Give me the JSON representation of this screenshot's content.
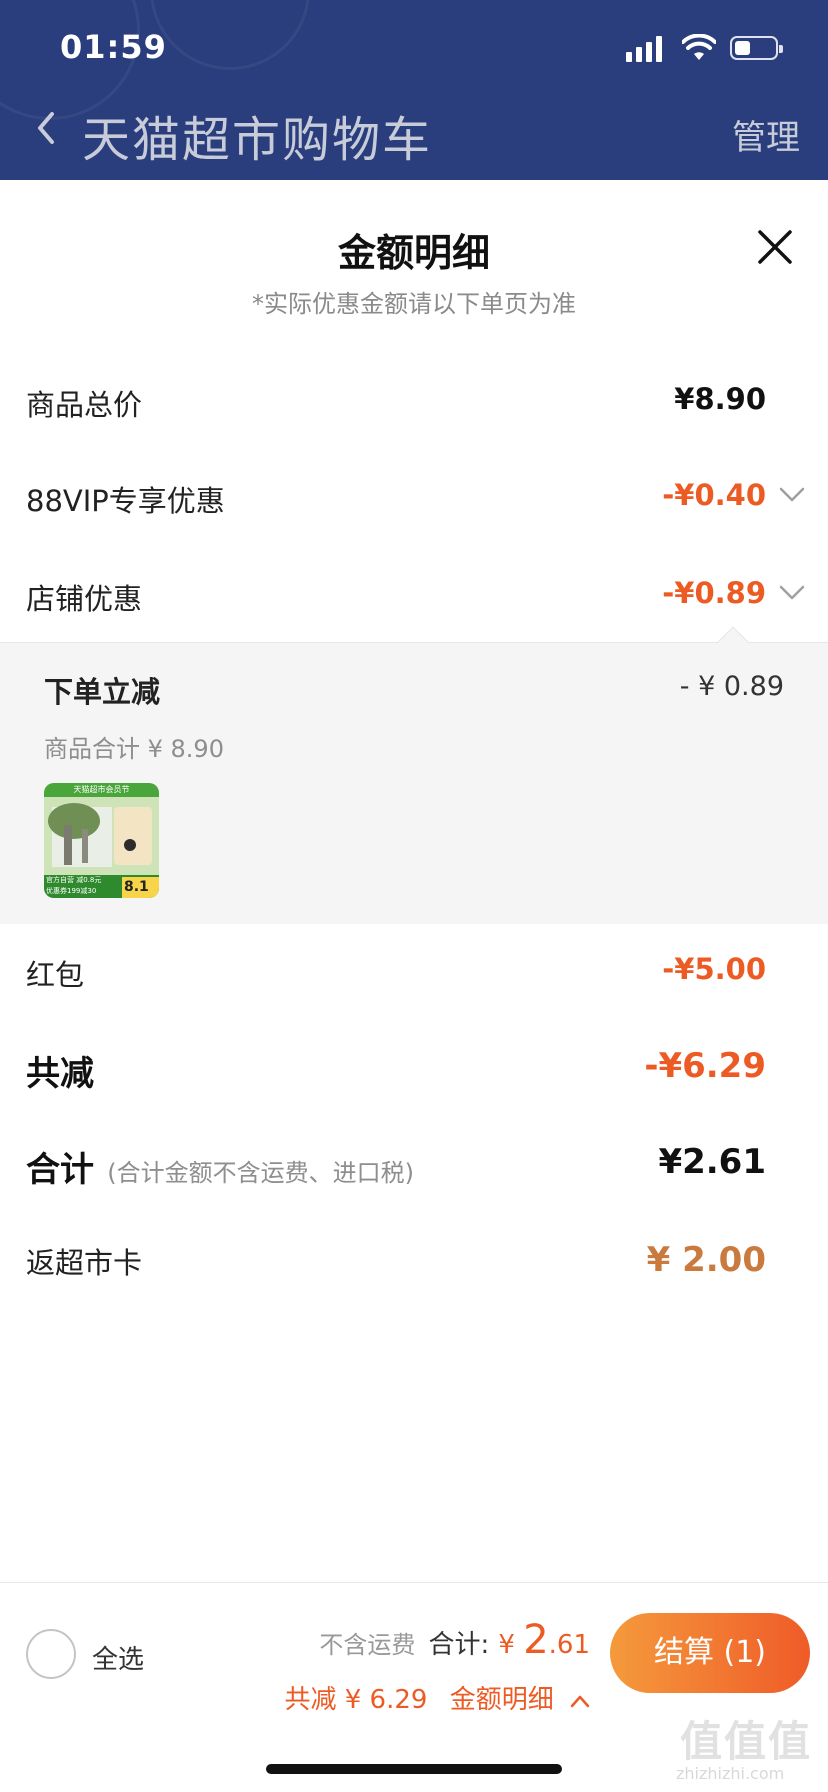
{
  "status_bar": {
    "time": "01:59"
  },
  "nav": {
    "title": "天猫超市购物车",
    "manage": "管理"
  },
  "sheet": {
    "title": "金额明细",
    "subtitle": "*实际优惠金额请以下单页为准",
    "rows": [
      {
        "label": "商品总价",
        "amount": "¥8.90"
      },
      {
        "label": "88VIP专享优惠",
        "amount": "-¥0.40"
      },
      {
        "label": "店铺优惠",
        "amount": "-¥0.89"
      }
    ],
    "store_discount_detail": {
      "title": "下单立减",
      "amount": "- ¥ 0.89",
      "subtotal": "商品合计 ¥ 8.90",
      "thumb_top_text": "天猫超市会员节",
      "thumb_badge_text": "官方自营 减0.8元",
      "thumb_coupon_text": "优惠券199减30",
      "thumb_price": "8.1"
    },
    "red_packet": {
      "label": "红包",
      "amount": "-¥5.00"
    },
    "total_discount": {
      "label": "共减",
      "amount": "-¥6.29"
    },
    "total": {
      "label": "合计",
      "note": "(合计金额不含运费、进口税)",
      "amount": "¥2.61"
    },
    "card_back": {
      "label": "返超市卡",
      "amount": "¥ 2.00"
    }
  },
  "bottom_bar": {
    "select_all": "全选",
    "excl_shipping": "不含运费",
    "total_label": "合计:",
    "currency": "¥ ",
    "total_int": "2",
    "total_dec": ".61",
    "saving_text": "共减 ¥ 6.29",
    "detail_link": "金额明细",
    "checkout": "结算 (1)"
  },
  "watermark": {
    "main": "值值值",
    "sub": "zhizhizhi.com"
  },
  "colors": {
    "header_bg": "#2a3d7c",
    "accent": "#ed5b25",
    "gold": "#c97a3c"
  }
}
